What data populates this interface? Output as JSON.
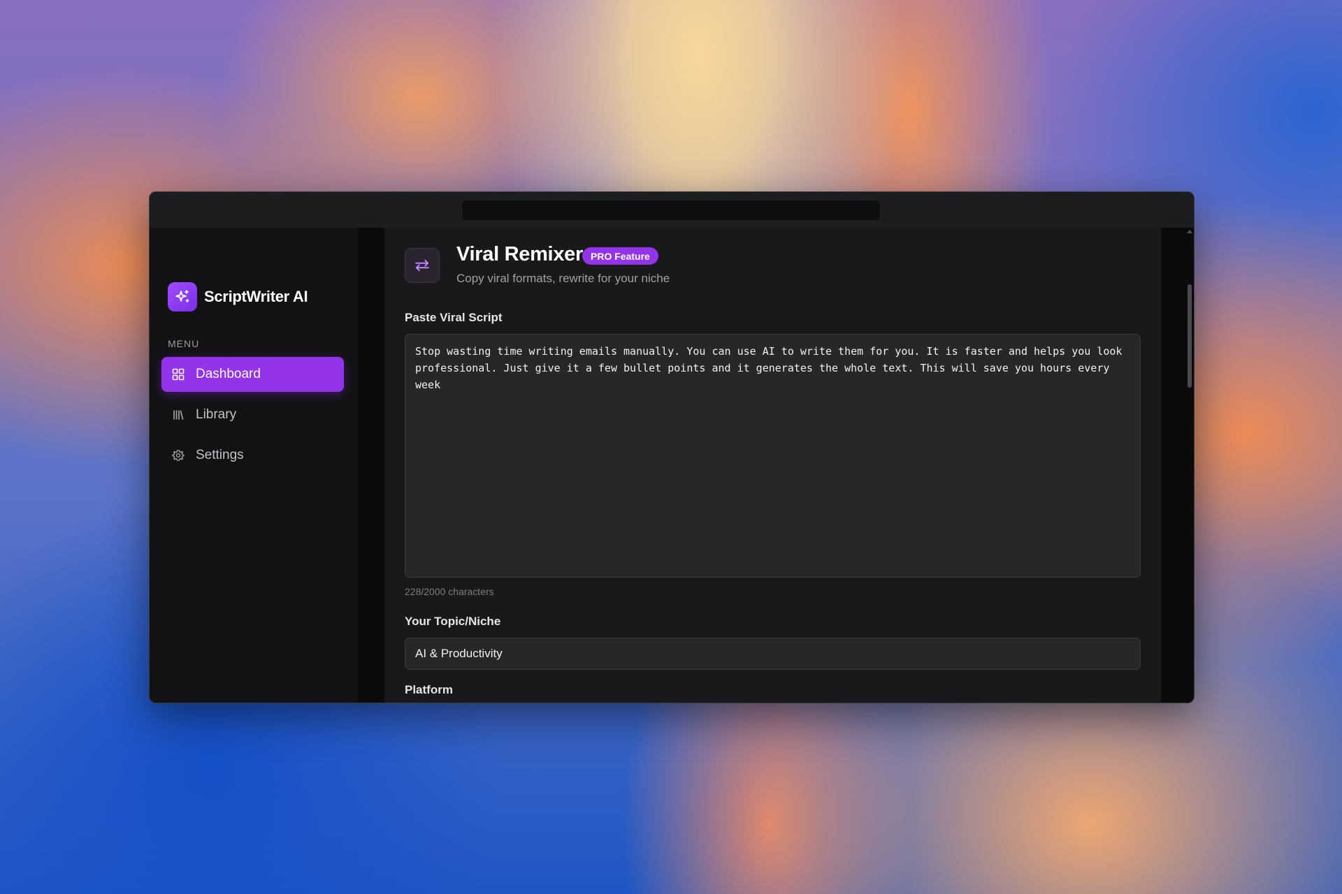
{
  "app": {
    "name": "ScriptWriter AI"
  },
  "sidebar": {
    "menu_label": "MENU",
    "items": [
      {
        "label": "Dashboard",
        "icon": "dashboard-grid-icon",
        "active": true
      },
      {
        "label": "Library",
        "icon": "library-icon",
        "active": false
      },
      {
        "label": "Settings",
        "icon": "gear-icon",
        "active": false
      }
    ]
  },
  "header": {
    "title": "Viral Remixer",
    "badge": "PRO Feature",
    "subtitle": "Copy viral formats, rewrite for your niche",
    "icon": "remix-arrows-icon"
  },
  "form": {
    "script_label": "Paste Viral Script",
    "script_value": "Stop wasting time writing emails manually. You can use AI to write them for you. It is faster and helps you look professional. Just give it a few bullet points and it generates the whole text. This will save you hours every week",
    "char_count": "228/2000 characters",
    "topic_label": "Your Topic/Niche",
    "topic_value": "AI & Productivity",
    "platform_label": "Platform"
  },
  "colors": {
    "accent": "#9333ea",
    "window_bg": "#19191b",
    "sidebar_bg": "#121214",
    "field_bg": "#27272a"
  }
}
